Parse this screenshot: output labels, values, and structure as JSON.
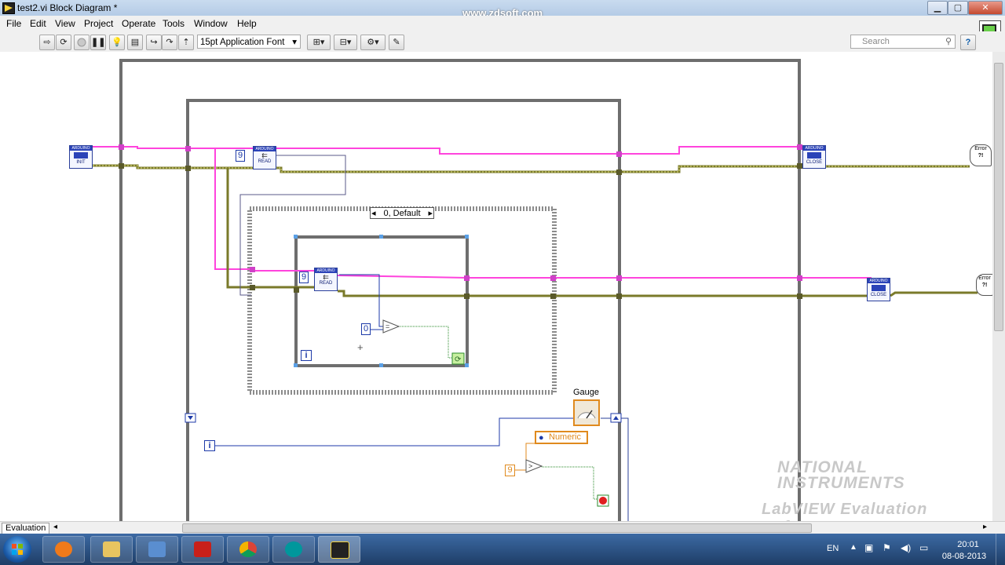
{
  "window": {
    "title": "test2.vi Block Diagram *",
    "watermark": "www.zdsoft.com",
    "minimize": "▁",
    "maximize": "▢",
    "close": "✕"
  },
  "menu": [
    "File",
    "Edit",
    "View",
    "Project",
    "Operate",
    "Tools",
    "Window",
    "Help"
  ],
  "toolbar": {
    "font": "15pt Application Font",
    "search_placeholder": "Search",
    "help": "?"
  },
  "diagram": {
    "case_selector": "0, Default",
    "gauge_label": "Gauge",
    "numeric_label": "Numeric",
    "constants": {
      "read1": "9",
      "read2": "9",
      "compare": "0",
      "numeric_in": "9"
    },
    "nodes": {
      "init": "INIT",
      "read": "READ",
      "close": "CLOSE",
      "node_header": "ARDUINO",
      "error": "Error"
    },
    "iteration": "i",
    "watermark_line1": "NATIONAL",
    "watermark_line2": "INSTRUMENTS",
    "watermark_line3": "LabVIEW Evaluation Software"
  },
  "statusbar": {
    "tab": "Evaluation"
  },
  "taskbar": {
    "lang": "EN",
    "time": "20:01",
    "date": "08-08-2013",
    "apps": [
      "media-player",
      "file-explorer",
      "control-panel",
      "acrobat",
      "chrome",
      "arduino",
      "labview"
    ]
  },
  "colors": {
    "wire_pink": "#ff44dd",
    "wire_olive": "#7a7a2a",
    "wire_blue": "#1d3aa8",
    "structure_gray": "#6e6e6e",
    "numeric_orange": "#e08a1e"
  }
}
